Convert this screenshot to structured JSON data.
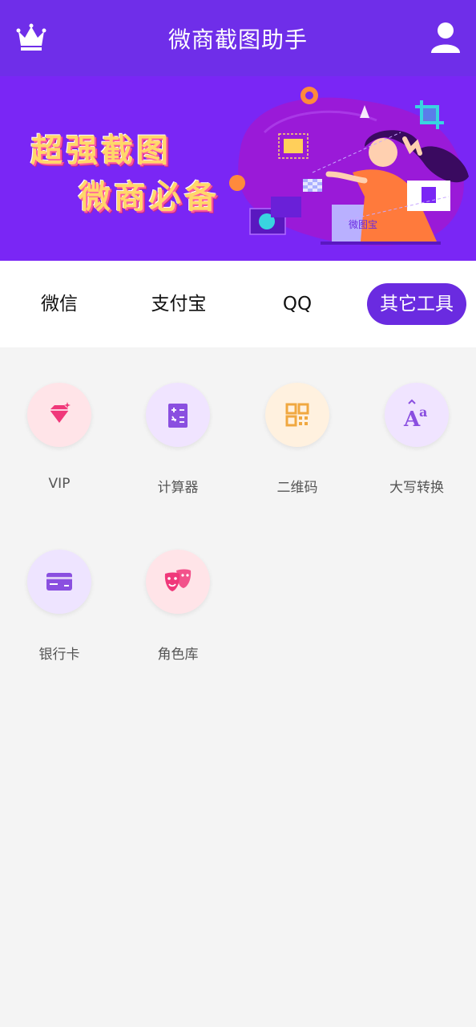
{
  "header": {
    "title": "微商截图助手",
    "left_icon": "crown-icon",
    "right_icon": "user-icon",
    "background": "#6f2ee9"
  },
  "banner": {
    "line1": "超强截图",
    "line2": "微商必备",
    "screen_text": "微图宝",
    "background": "#7a26f5"
  },
  "tabs": [
    {
      "label": "微信",
      "active": false
    },
    {
      "label": "支付宝",
      "active": false
    },
    {
      "label": "QQ",
      "active": false
    },
    {
      "label": "其它工具",
      "active": true
    }
  ],
  "accent": "#6a2be0",
  "tools": [
    {
      "label": "VIP",
      "icon": "diamond-icon",
      "bg": "#ffe4e8",
      "color": "#f0387a"
    },
    {
      "label": "计算器",
      "icon": "calculator-icon",
      "bg": "#f0e4ff",
      "color": "#8a4fe0"
    },
    {
      "label": "二维码",
      "icon": "qrcode-icon",
      "bg": "#fff1df",
      "color": "#f0a840"
    },
    {
      "label": "大写转换",
      "icon": "font-case-icon",
      "bg": "#f0e4ff",
      "color": "#8a4fe0"
    },
    {
      "label": "银行卡",
      "icon": "bank-card-icon",
      "bg": "#eee4ff",
      "color": "#8a4fe0"
    },
    {
      "label": "角色库",
      "icon": "masks-icon",
      "bg": "#ffe4e8",
      "color": "#f0387a"
    }
  ]
}
